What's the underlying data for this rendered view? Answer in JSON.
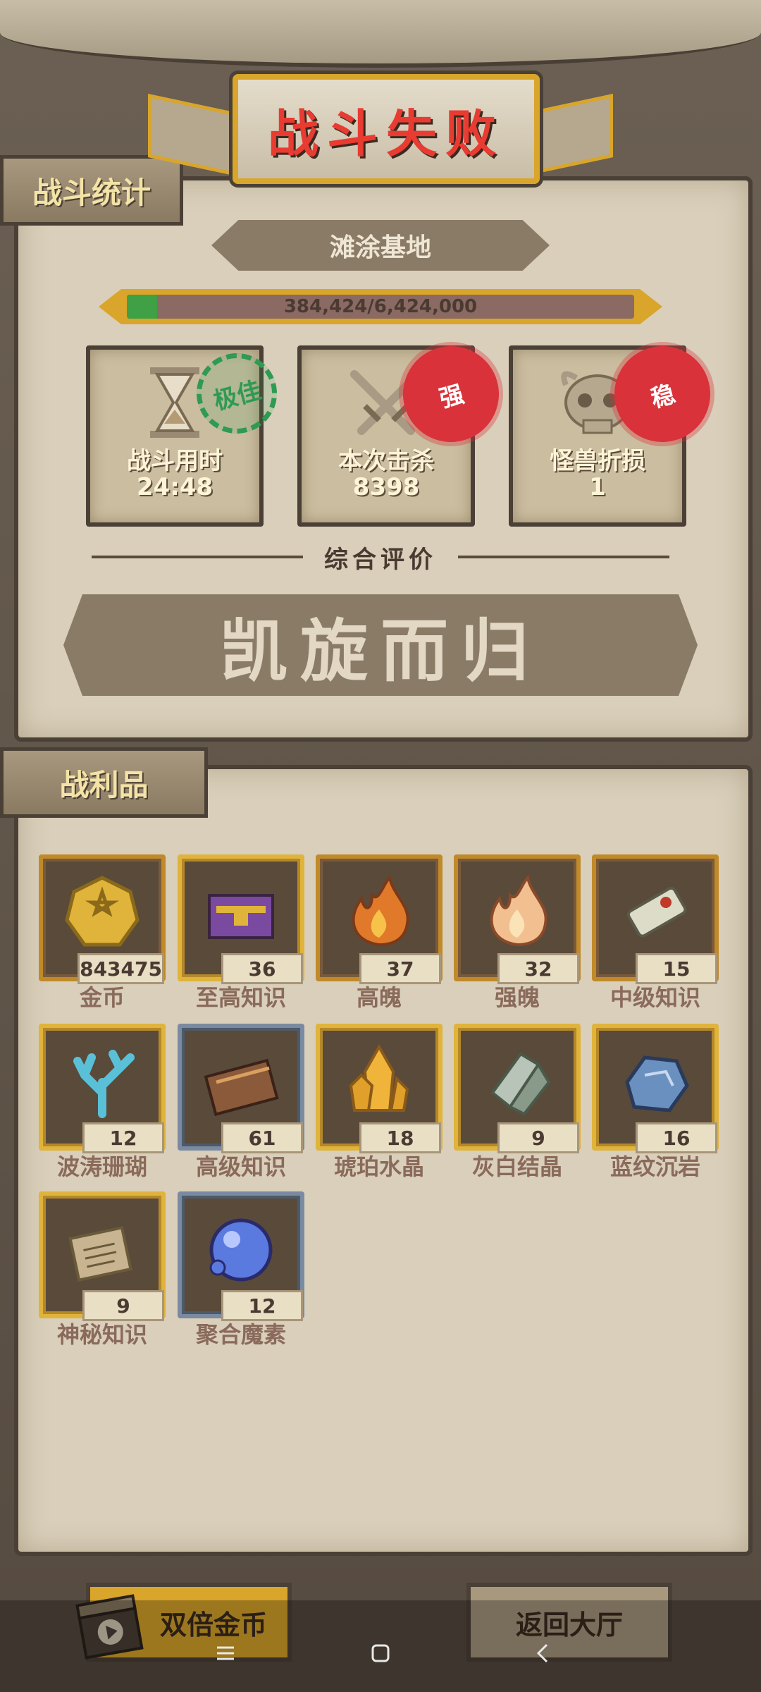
{
  "title": "战斗失败",
  "stats_section": {
    "tab_label": "战斗统计",
    "location": "滩涂基地",
    "progress": {
      "text": "384,424/6,424,000",
      "current": 384424,
      "total": 6424000
    },
    "cards": [
      {
        "label": "战斗用时",
        "value": "24:48",
        "stamp": "极佳"
      },
      {
        "label": "本次击杀",
        "value": "8398",
        "stamp": "强"
      },
      {
        "label": "怪兽折损",
        "value": "1",
        "stamp": "稳"
      }
    ],
    "rating_label": "综合评价",
    "rating_value": "凯旋而归"
  },
  "loot_section": {
    "tab_label": "战利品",
    "items": [
      {
        "name": "金币",
        "qty": "843475",
        "icon": "gold-coin-icon",
        "frame": "bronze"
      },
      {
        "name": "至高知识",
        "qty": "36",
        "icon": "purple-book-icon",
        "frame": "gold"
      },
      {
        "name": "高魄",
        "qty": "37",
        "icon": "fire-orange-icon",
        "frame": "bronze"
      },
      {
        "name": "强魄",
        "qty": "32",
        "icon": "fire-light-icon",
        "frame": "bronze"
      },
      {
        "name": "中级知识",
        "qty": "15",
        "icon": "scroll-icon",
        "frame": "bronze"
      },
      {
        "name": "波涛珊瑚",
        "qty": "12",
        "icon": "coral-icon",
        "frame": "gold"
      },
      {
        "name": "高级知识",
        "qty": "61",
        "icon": "brown-book-icon",
        "frame": "silver"
      },
      {
        "name": "琥珀水晶",
        "qty": "18",
        "icon": "amber-crystal-icon",
        "frame": "gold"
      },
      {
        "name": "灰白结晶",
        "qty": "9",
        "icon": "grey-crystal-icon",
        "frame": "gold"
      },
      {
        "name": "蓝纹沉岩",
        "qty": "16",
        "icon": "blue-rock-icon",
        "frame": "gold"
      },
      {
        "name": "神秘知识",
        "qty": "9",
        "icon": "stone-tablet-icon",
        "frame": "gold"
      },
      {
        "name": "聚合魔素",
        "qty": "12",
        "icon": "blue-orb-icon",
        "frame": "silver"
      }
    ]
  },
  "buttons": {
    "double_gold": "双倍金币",
    "return_lobby": "返回大厅"
  },
  "colors": {
    "title_red": "#e83b32",
    "gold_frame": "#d9a52a",
    "progress_green": "#3fa045",
    "panel": "#d9cfba"
  }
}
